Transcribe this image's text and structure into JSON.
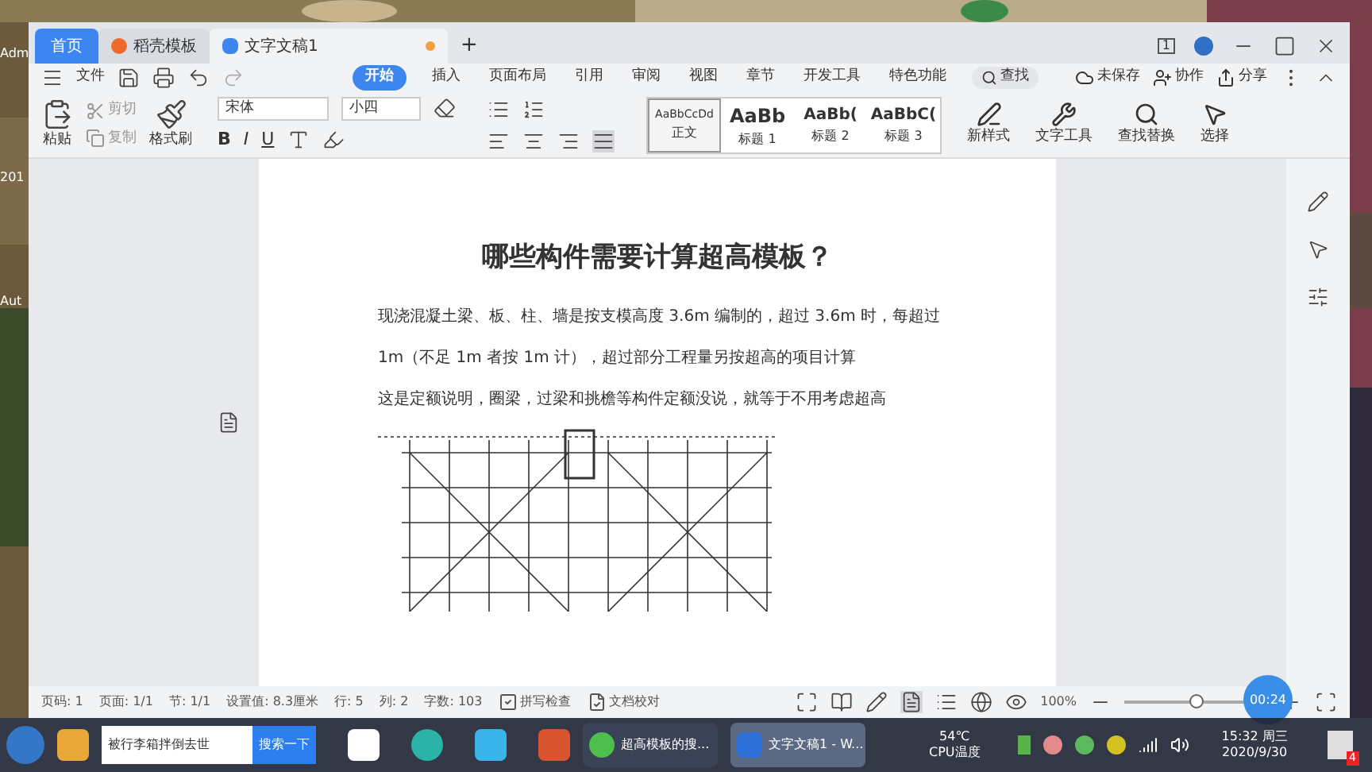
{
  "desktop_icons": [
    "Adm",
    "201",
    "Aut"
  ],
  "tabs": [
    {
      "label": "首页",
      "kind": "home",
      "selected": false
    },
    {
      "label": "稻壳模板",
      "kind": "template",
      "selected": false
    },
    {
      "label": "文字文稿1",
      "kind": "doc",
      "selected": true,
      "unsaved": true
    }
  ],
  "new_tab": "+",
  "page_badge": "1",
  "menu": {
    "file": "文件",
    "items": [
      {
        "label": "开始",
        "selected": true
      },
      {
        "label": "插入",
        "selected": false
      },
      {
        "label": "页面布局",
        "selected": false
      },
      {
        "label": "引用",
        "selected": false
      },
      {
        "label": "审阅",
        "selected": false
      },
      {
        "label": "视图",
        "selected": false
      },
      {
        "label": "章节",
        "selected": false
      },
      {
        "label": "开发工具",
        "selected": false
      },
      {
        "label": "特色功能",
        "selected": false
      }
    ],
    "search": "查找",
    "actions": [
      "未保存",
      "协作",
      "分享"
    ]
  },
  "ribbon": {
    "paste": "粘贴",
    "cut": "剪切",
    "copy": "复制",
    "format_painter": "格式刷",
    "font": "宋体",
    "size": "小四",
    "format_keys": [
      "B",
      "I",
      "U"
    ],
    "styles": [
      {
        "preview": "AaBbCcDd",
        "label": "正文",
        "selected": true
      },
      {
        "preview": "AaBb",
        "label": "标题 1",
        "selected": false
      },
      {
        "preview": "AaBb(",
        "label": "标题 2",
        "selected": false
      },
      {
        "preview": "AaBbC(",
        "label": "标题 3",
        "selected": false
      }
    ],
    "tools": [
      "新样式",
      "文字工具",
      "查找替换",
      "选择"
    ]
  },
  "document": {
    "title": "哪些构件需要计算超高模板？",
    "paragraphs": [
      "现浇混凝土梁、板、柱、墙是按支模高度 3.6m 编制的，超过 3.6m 时，每超过",
      "1m（不足 1m 者按 1m 计），超过部分工程量另按超高的项目计算",
      "这是定额说明，圈梁，过梁和挑檐等构件定额没说，就等于不用考虑超高"
    ]
  },
  "status_bar": {
    "fields": [
      "页码: 1",
      "页面: 1/1",
      "节: 1/1",
      "设置值: 8.3厘米",
      "行: 5",
      "列: 2",
      "字数: 103"
    ],
    "checks": [
      "拼写检查",
      "文档校对"
    ],
    "zoom": "100%",
    "level": 0.5,
    "timer": "00:24"
  },
  "taskbar": {
    "search_text": "被行李箱拌倒去世",
    "search_button": "搜索一下",
    "windows": [
      {
        "label": "超高模板的搜...",
        "selected": false
      },
      {
        "label": "文字文稿1 - W...",
        "selected": true
      }
    ],
    "temperature": "54℃",
    "temperature_label": "CPU温度",
    "time": "15:32 周三",
    "date": "2020/9/30",
    "notifications": "4"
  }
}
